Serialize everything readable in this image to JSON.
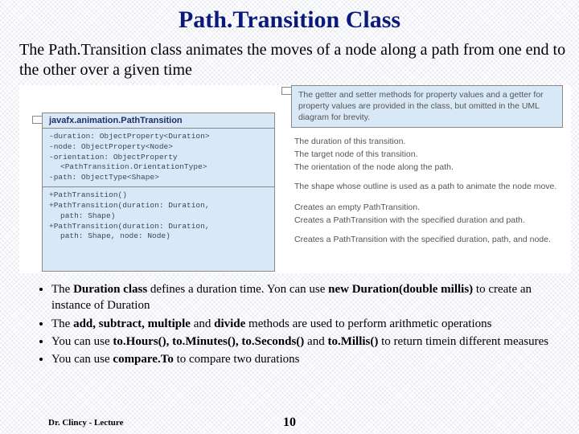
{
  "title": "Path.Transition Class",
  "lead": "The Path.Transition class animates the moves of a node along a path from one end to the other over a given time",
  "uml": {
    "header": "javafx.animation.PathTransition",
    "attrs": [
      "-duration: ObjectProperty<Duration>",
      "-node: ObjectProperty<Node>",
      "-orientation: ObjectProperty",
      "<PathTransition.OrientationType>",
      "-path: ObjectType<Shape>"
    ],
    "ctors": [
      "+PathTransition()",
      "+PathTransition(duration: Duration,",
      "path: Shape)",
      "+PathTransition(duration: Duration,",
      "path: Shape, node: Node)"
    ]
  },
  "note": "The getter and setter methods for property values and a getter for property values are provided in the class, but omitted in the UML diagram for brevity.",
  "desc": {
    "d1": "The duration of this transition.",
    "d2": "The target node of this transition.",
    "d3": "The orientation of the node along the path.",
    "d4": "The shape whose outline is used as a path to animate the node move.",
    "d5": "Creates an empty PathTransition.",
    "d6": "Creates a PathTransition with the specified duration and path.",
    "d7": "Creates a PathTransition with the specified duration, path, and node."
  },
  "bullets": {
    "b1a": "The ",
    "b1b": "Duration class",
    "b1c": " defines a duration time. Yon can use ",
    "b1d": "new Duration(double millis)",
    "b1e": " to create an instance of Duration",
    "b2a": "The ",
    "b2b": "add, subtract, multiple",
    "b2c": " and ",
    "b2d": "divide",
    "b2e": " methods are used to perform arithmetic operations",
    "b3a": "You can use ",
    "b3b": "to.Hours(), to.Minutes(), to.Seconds()",
    "b3c": " and ",
    "b3d": "to.Millis()",
    "b3e": " to return timein different measures",
    "b4a": "You can use ",
    "b4b": "compare.To",
    "b4c": " to compare two durations"
  },
  "footer": {
    "lecture": "Dr. Clincy - Lecture",
    "page": "10"
  }
}
